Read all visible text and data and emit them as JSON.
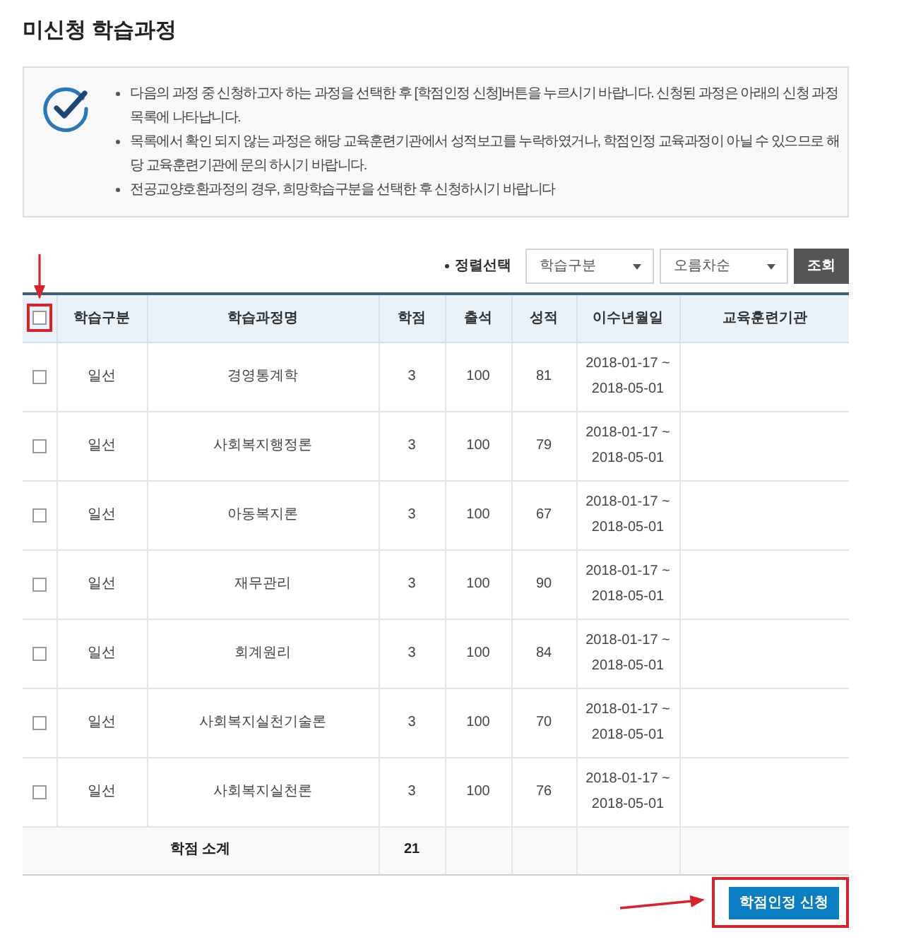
{
  "page": {
    "title": "미신청 학습과정"
  },
  "notice": {
    "items": [
      "다음의 과정 중 신청하고자 하는 과정을 선택한 후 [학점인정 신청]버튼을 누르시기 바랍니다. 신청된 과정은 아래의 신청 과정 목록에 나타납니다.",
      "목록에서 확인 되지 않는 과정은 해당 교육훈련기관에서 성적보고를 누락하였거나, 학점인정 교육과정이 아닐 수 있으므로 해당 교육훈련기관에 문의 하시기 바랍니다.",
      "전공교양호환과정의 경우, 희망학습구분을 선택한 후 신청하시기 바랍니다"
    ]
  },
  "sort": {
    "label": "정렬선택",
    "field": "학습구분",
    "order": "오름차순",
    "button": "조회"
  },
  "table": {
    "select_all": {
      "checked": false,
      "highlighted": true,
      "arrow": true
    },
    "columns": [
      "학습구분",
      "학습과정명",
      "학점",
      "출석",
      "성적",
      "이수년월일",
      "교육훈련기관"
    ],
    "rows": [
      {
        "checked": false,
        "category": "일선",
        "course": "경영통계학",
        "credits": "3",
        "attendance": "100",
        "score": "81",
        "period": "2018-01-17 ~ 2018-05-01"
      },
      {
        "checked": false,
        "category": "일선",
        "course": "사회복지행정론",
        "credits": "3",
        "attendance": "100",
        "score": "79",
        "period": "2018-01-17 ~ 2018-05-01"
      },
      {
        "checked": false,
        "category": "일선",
        "course": "아동복지론",
        "credits": "3",
        "attendance": "100",
        "score": "67",
        "period": "2018-01-17 ~ 2018-05-01"
      },
      {
        "checked": false,
        "category": "일선",
        "course": "재무관리",
        "credits": "3",
        "attendance": "100",
        "score": "90",
        "period": "2018-01-17 ~ 2018-05-01"
      },
      {
        "checked": false,
        "category": "일선",
        "course": "회계원리",
        "credits": "3",
        "attendance": "100",
        "score": "84",
        "period": "2018-01-17 ~ 2018-05-01"
      },
      {
        "checked": false,
        "category": "일선",
        "course": "사회복지실천기술론",
        "credits": "3",
        "attendance": "100",
        "score": "70",
        "period": "2018-01-17 ~ 2018-05-01"
      },
      {
        "checked": false,
        "category": "일선",
        "course": "사회복지실천론",
        "credits": "3",
        "attendance": "100",
        "score": "76",
        "period": "2018-01-17 ~ 2018-05-01"
      }
    ],
    "footer": {
      "label": "학점 소계",
      "credits": "21"
    }
  },
  "submit_button": {
    "label": "학점인정 신청",
    "highlighted": true,
    "arrow": true
  }
}
